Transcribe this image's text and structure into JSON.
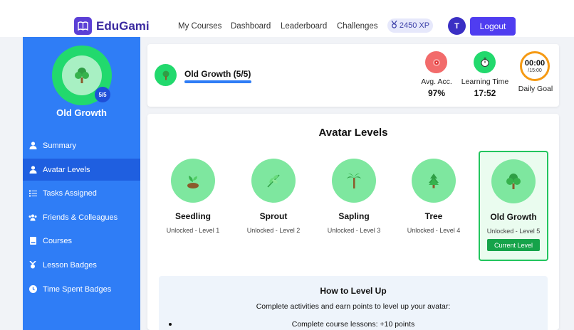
{
  "app": {
    "name": "EduGami"
  },
  "nav": {
    "items": [
      "My Courses",
      "Dashboard",
      "Leaderboard",
      "Challenges"
    ],
    "xp": "2450 XP",
    "user_initial": "T",
    "logout": "Logout"
  },
  "sidebar": {
    "avatar_level_badge": "5/5",
    "avatar_name": "Old Growth",
    "items": [
      {
        "label": "Summary",
        "icon": "user-icon"
      },
      {
        "label": "Avatar Levels",
        "icon": "user-icon",
        "active": true
      },
      {
        "label": "Tasks Assigned",
        "icon": "list-icon"
      },
      {
        "label": "Friends & Colleagues",
        "icon": "users-icon"
      },
      {
        "label": "Courses",
        "icon": "book-icon"
      },
      {
        "label": "Lesson Badges",
        "icon": "badge-icon"
      },
      {
        "label": "Time Spent Badges",
        "icon": "clock-icon"
      }
    ]
  },
  "stats": {
    "title": "Old Growth (5/5)",
    "progress_percent": 100,
    "avg_acc_label": "Avg. Acc.",
    "avg_acc_value": "97%",
    "learning_time_label": "Learning Time",
    "learning_time_value": "17:52",
    "daily_goal_time": "00:00",
    "daily_goal_target": "/15:00",
    "daily_goal_label": "Daily Goal"
  },
  "levels": {
    "title": "Avatar Levels",
    "items": [
      {
        "name": "Seedling",
        "status": "Unlocked - Level 1",
        "icon": "seedling-icon"
      },
      {
        "name": "Sprout",
        "status": "Unlocked - Level 2",
        "icon": "sprout-icon"
      },
      {
        "name": "Sapling",
        "status": "Unlocked - Level 3",
        "icon": "palm-icon"
      },
      {
        "name": "Tree",
        "status": "Unlocked - Level 4",
        "icon": "pine-icon"
      },
      {
        "name": "Old Growth",
        "status": "Unlocked - Level 5",
        "icon": "tree-icon"
      }
    ],
    "current_label": "Current Level"
  },
  "howto": {
    "title": "How to Level Up",
    "desc": "Complete activities and earn points to level up your avatar:",
    "items": [
      "Complete course lessons: +10 points"
    ]
  },
  "colors": {
    "brand": "#5b3fd6",
    "sidebar": "#2f7df6",
    "green": "#22d96d",
    "accuracy": "#f26b6b",
    "goal": "#f59a14"
  }
}
